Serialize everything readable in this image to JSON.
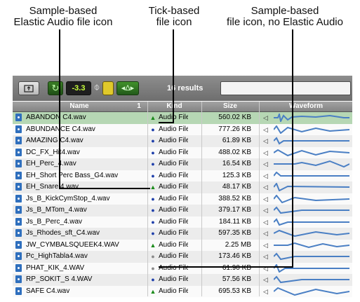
{
  "callouts": {
    "elastic": "Sample-based\nElastic Audio file icon",
    "tick": "Tick-based\nfile icon",
    "no_elastic": "Sample-based\nfile icon, no Elastic Audio"
  },
  "toolbar": {
    "volume": "-3.3",
    "results_count": "16 results",
    "search_value": ""
  },
  "columns": {
    "name": "Name",
    "sort_index": "1",
    "kind": "Kind",
    "size": "Size",
    "waveform": "Waveform"
  },
  "files": [
    {
      "name": "ABANDON C4.wav",
      "icon": "elastic",
      "kind": "Audio File",
      "size": "560.02 KB",
      "selected": true
    },
    {
      "name": "ABUNDANCE C4.wav",
      "icon": "tick",
      "kind": "Audio File",
      "size": "777.26 KB"
    },
    {
      "name": "AMAZING C4.wav",
      "icon": "tick",
      "kind": "Audio File",
      "size": "61.89 KB"
    },
    {
      "name": "DC_FX_Hit4.wav",
      "icon": "tick",
      "kind": "Audio File",
      "size": "488.02 KB"
    },
    {
      "name": "EH_Perc_4.wav",
      "icon": "tick",
      "kind": "Audio File",
      "size": "16.54 KB"
    },
    {
      "name": "EH_Short Perc Bass_G4.wav",
      "icon": "tick",
      "kind": "Audio File",
      "size": "125.3 KB"
    },
    {
      "name": "EH_Snare 4.wav",
      "icon": "elastic",
      "kind": "Audio File",
      "size": "48.17 KB"
    },
    {
      "name": "Js_B_KickCymStop_4.wav",
      "icon": "tick",
      "kind": "Audio File",
      "size": "388.52 KB"
    },
    {
      "name": "Js_B_MTom_4.wav",
      "icon": "tick",
      "kind": "Audio File",
      "size": "379.17 KB"
    },
    {
      "name": "Js_B_Perc_4.wav",
      "icon": "tick",
      "kind": "Audio File",
      "size": "184.11 KB"
    },
    {
      "name": "Js_Rhodes_sft_C4.wav",
      "icon": "tick",
      "kind": "Audio File",
      "size": "597.35 KB"
    },
    {
      "name": "JW_CYMBALSQUEEK4.WAV",
      "icon": "elastic",
      "kind": "Audio File",
      "size": "2.25 MB"
    },
    {
      "name": "Pc_HighTabla4.wav",
      "icon": "plain",
      "kind": "Audio File",
      "size": "173.46 KB"
    },
    {
      "name": "PHAT_KIK_4.WAV",
      "icon": "plain",
      "kind": "Audio File",
      "size": "61.90 KB"
    },
    {
      "name": "RP_SOKIT_S 4.WAV",
      "icon": "tick",
      "kind": "Audio File",
      "size": "57.56 KB"
    },
    {
      "name": "SAFE C4.wav",
      "icon": "elastic",
      "kind": "Audio File",
      "size": "695.53 KB"
    }
  ],
  "colors": {
    "selected_row": "#b6d7b4",
    "elastic_icon": "#1a8a1a",
    "tick_icon": "#1f3faa",
    "waveform": "#4a7fc4"
  }
}
